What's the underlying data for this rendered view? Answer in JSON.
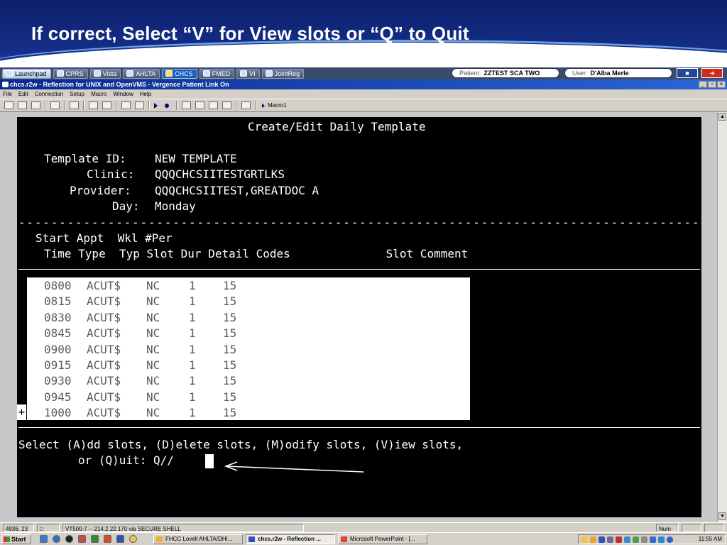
{
  "slide": {
    "title": "If correct, Select “V” for View slots or “Q” to Quit"
  },
  "launchbar": {
    "buttons": [
      {
        "label": "Launchpad",
        "icon": "launchpad-icon"
      },
      {
        "label": "CPRS",
        "icon": "cprs-icon"
      },
      {
        "label": "Vista",
        "icon": "vista-icon"
      },
      {
        "label": "AHLTA",
        "icon": "ahlta-icon"
      },
      {
        "label": "CHCS",
        "icon": "chcs-icon"
      },
      {
        "label": "FMED",
        "icon": "fmed-icon"
      },
      {
        "label": "VI",
        "icon": "vi-icon"
      },
      {
        "label": "JointReg",
        "icon": "jointreg-icon"
      }
    ],
    "patient_label": "Patient:",
    "patient_value": "ZZTEST SCA TWO",
    "user_label": "User:",
    "user_value": "D'Alba Merle"
  },
  "window": {
    "title": "chcs.r2w - Reflection for UNIX and OpenVMS - Vergence Patient Link On",
    "controls": [
      "_",
      "▫",
      "×"
    ]
  },
  "menu": [
    "File",
    "Edit",
    "Connection",
    "Setup",
    "Macro",
    "Window",
    "Help"
  ],
  "toolbar": {
    "macro_label": "Macro1"
  },
  "terminal": {
    "header": "Create/Edit Daily Template",
    "template_id_label": "Template ID:",
    "template_id_value": "NEW TEMPLATE",
    "clinic_label": "Clinic:",
    "clinic_value": "QQQCHCSIITESTGRTLKS",
    "provider_label": "Provider:",
    "provider_value": "QQQCHCSIITEST,GREATDOC A",
    "day_label": "Day:",
    "day_value": "Monday",
    "dash_line": "------------------------------------------------------------------------------------",
    "col_header_1": "Start Appt  Wkl #Per",
    "col_header_2": "Time Type  Typ Slot Dur Detail Codes              Slot Comment",
    "slots": [
      {
        "time": "0800",
        "type": "ACUT$",
        "wkl": "NC",
        "per": "1",
        "dur": "15"
      },
      {
        "time": "0815",
        "type": "ACUT$",
        "wkl": "NC",
        "per": "1",
        "dur": "15"
      },
      {
        "time": "0830",
        "type": "ACUT$",
        "wkl": "NC",
        "per": "1",
        "dur": "15"
      },
      {
        "time": "0845",
        "type": "ACUT$",
        "wkl": "NC",
        "per": "1",
        "dur": "15"
      },
      {
        "time": "0900",
        "type": "ACUT$",
        "wkl": "NC",
        "per": "1",
        "dur": "15"
      },
      {
        "time": "0915",
        "type": "ACUT$",
        "wkl": "NC",
        "per": "1",
        "dur": "15"
      },
      {
        "time": "0930",
        "type": "ACUT$",
        "wkl": "NC",
        "per": "1",
        "dur": "15"
      },
      {
        "time": "0945",
        "type": "ACUT$",
        "wkl": "NC",
        "per": "1",
        "dur": "15"
      },
      {
        "time": "1000",
        "type": "ACUT$",
        "wkl": "NC",
        "per": "1",
        "dur": "15"
      }
    ],
    "more_marker": "+",
    "prompt_line_1": "Select (A)dd slots, (D)elete slots, (M)odify slots, (V)iew slots,",
    "prompt_line_2": "or (Q)uit: Q//"
  },
  "statusbar": {
    "cursor_pos": "4936, 23",
    "connection": "VT500-7 -- 214.2.22.170 via SECURE SHELL",
    "num": "Num"
  },
  "taskbar": {
    "start_label": "Start",
    "tasks": [
      {
        "label": "FHCC Lovell AHLTA/DHI...",
        "pressed": false
      },
      {
        "label": "chcs.r2w - Reflection ...",
        "pressed": true
      },
      {
        "label": "Microsoft PowerPoint - [...",
        "pressed": false
      }
    ],
    "clock": "11:55 AM"
  }
}
